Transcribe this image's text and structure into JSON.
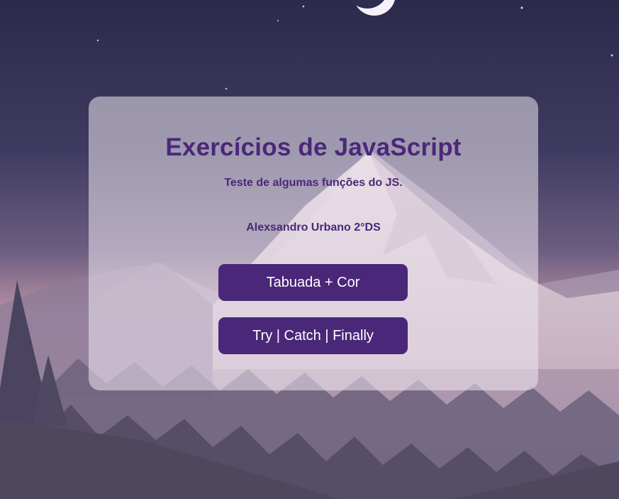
{
  "page": {
    "title": "Exercícios de JavaScript",
    "subtitle": "Teste de algumas funções do JS.",
    "author": "Alexsandro Urbano 2°DS"
  },
  "buttons": {
    "tabuada_label": "Tabuada + Cor",
    "try_catch_label": "Try | Catch | Finally"
  },
  "colors": {
    "accent": "#4b2779",
    "button_text": "#ffffff",
    "card_bg": "rgba(238,232,240,0.55)"
  },
  "icons": {
    "background": "mountain-landscape-illustration",
    "moon": "crescent-moon-icon"
  }
}
